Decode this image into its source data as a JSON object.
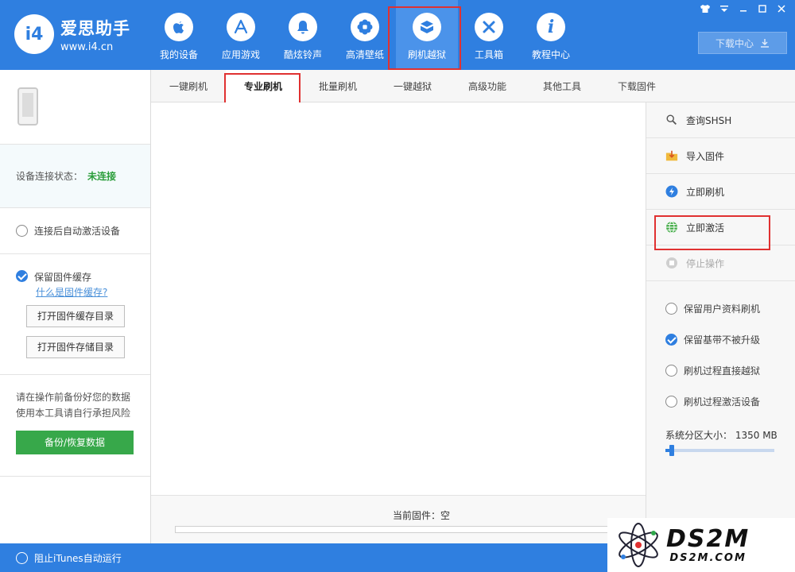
{
  "header": {
    "logo_mark": "i4",
    "logo_name": "爱思助手",
    "logo_url": "www.i4.cn",
    "nav": [
      {
        "label": "我的设备",
        "icon": "apple-icon",
        "glyph": ""
      },
      {
        "label": "应用游戏",
        "icon": "app-store-icon",
        "glyph": "A"
      },
      {
        "label": "酷炫铃声",
        "icon": "bell-icon",
        "glyph": "🔔"
      },
      {
        "label": "高清壁纸",
        "icon": "flower-icon",
        "glyph": "✿"
      },
      {
        "label": "刷机越狱",
        "icon": "box-icon",
        "glyph": "❒"
      },
      {
        "label": "工具箱",
        "icon": "tools-icon",
        "glyph": "✕"
      },
      {
        "label": "教程中心",
        "icon": "info-icon",
        "glyph": "i"
      }
    ],
    "download_center": "下载中心",
    "win_controls": [
      "👕",
      "▾",
      "–",
      "□",
      "✕"
    ]
  },
  "sidebar": {
    "status_label": "设备连接状态：",
    "status_value": "未连接",
    "auto_activate": "连接后自动激活设备",
    "keep_cache": "保留固件缓存",
    "what_is_cache": "什么是固件缓存?",
    "open_cache_dir": "打开固件缓存目录",
    "open_storage_dir": "打开固件存储目录",
    "warning_line1": "请在操作前备份好您的数据",
    "warning_line2": "使用本工具请自行承担风险",
    "backup_button": "备份/恢复数据"
  },
  "tabs": [
    "一键刷机",
    "专业刷机",
    "批量刷机",
    "一键越狱",
    "高级功能",
    "其他工具",
    "下载固件"
  ],
  "active_tab": 1,
  "main": {
    "current_firmware": "当前固件：空",
    "progress": 0
  },
  "right_panel": {
    "actions": [
      {
        "label": "查询SHSH",
        "icon": "search-shsh-icon"
      },
      {
        "label": "导入固件",
        "icon": "import-icon"
      },
      {
        "label": "立即刷机",
        "icon": "flash-icon"
      },
      {
        "label": "立即激活",
        "icon": "globe-icon"
      },
      {
        "label": "停止操作",
        "icon": "stop-icon"
      }
    ],
    "options": [
      {
        "label": "保留用户资料刷机",
        "checked": false
      },
      {
        "label": "保留基带不被升级",
        "checked": true
      },
      {
        "label": "刷机过程直接越狱",
        "checked": false
      },
      {
        "label": "刷机过程激活设备",
        "checked": false
      }
    ],
    "partition_label": "系统分区大小：",
    "partition_value": "1350 MB",
    "partition_fraction": 0.06
  },
  "footer": {
    "block_itunes": "阻止iTunes自动运行"
  },
  "watermark": {
    "big": "DS2M",
    "small": "DS2M.COM"
  }
}
